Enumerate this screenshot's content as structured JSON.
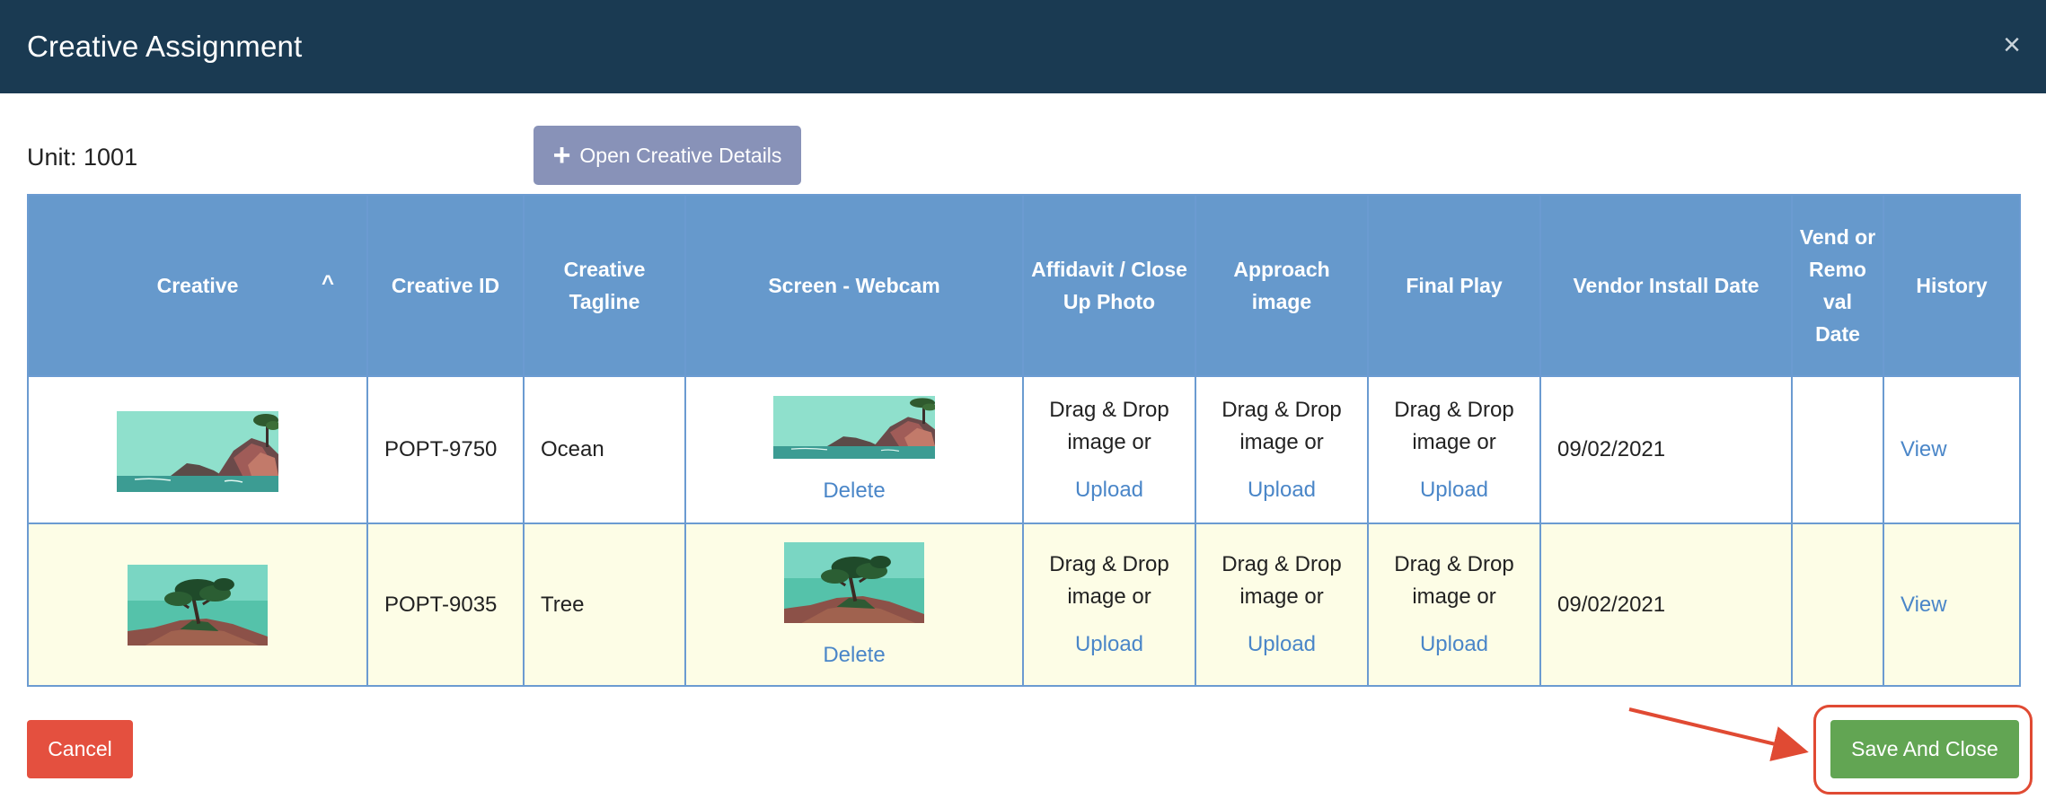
{
  "dialog": {
    "title": "Creative Assignment",
    "close_glyph": "×",
    "unit_label": "Unit: 1001",
    "open_details_label": "Open Creative Details",
    "open_details_icon": "plus-icon"
  },
  "table": {
    "headers": {
      "creative": "Creative",
      "creative_id": "Creative ID",
      "tagline": "Creative Tagline",
      "screen": "Screen - Webcam",
      "affidavit": "Affidavit / Close Up Photo",
      "approach": "Approach image",
      "final_play": "Final Play",
      "install_date": "Vendor Install Date",
      "removal_date": "Vend or Remo val Date",
      "history": "History"
    },
    "sort_glyph": "^",
    "drop_text": "Drag & Drop image or",
    "upload_label": "Upload",
    "delete_label": "Delete",
    "view_label": "View",
    "rows": [
      {
        "creative_id": "POPT-9750",
        "tagline": "Ocean",
        "install_date": "09/02/2021",
        "removal_date": "",
        "thumb": "ocean-coast-image"
      },
      {
        "creative_id": "POPT-9035",
        "tagline": "Tree",
        "install_date": "09/02/2021",
        "removal_date": "",
        "thumb": "cypress-tree-image"
      }
    ]
  },
  "footer": {
    "cancel_label": "Cancel",
    "save_label": "Save And Close",
    "highlight_color": "#e04a33"
  },
  "colors": {
    "header_bg": "#1a3a52",
    "table_header_bg": "#6699cc",
    "row_alt_bg": "#fdfde6",
    "link": "#4a86c8",
    "cancel": "#e4503f",
    "save": "#62a553",
    "open_details": "#8892b8"
  }
}
